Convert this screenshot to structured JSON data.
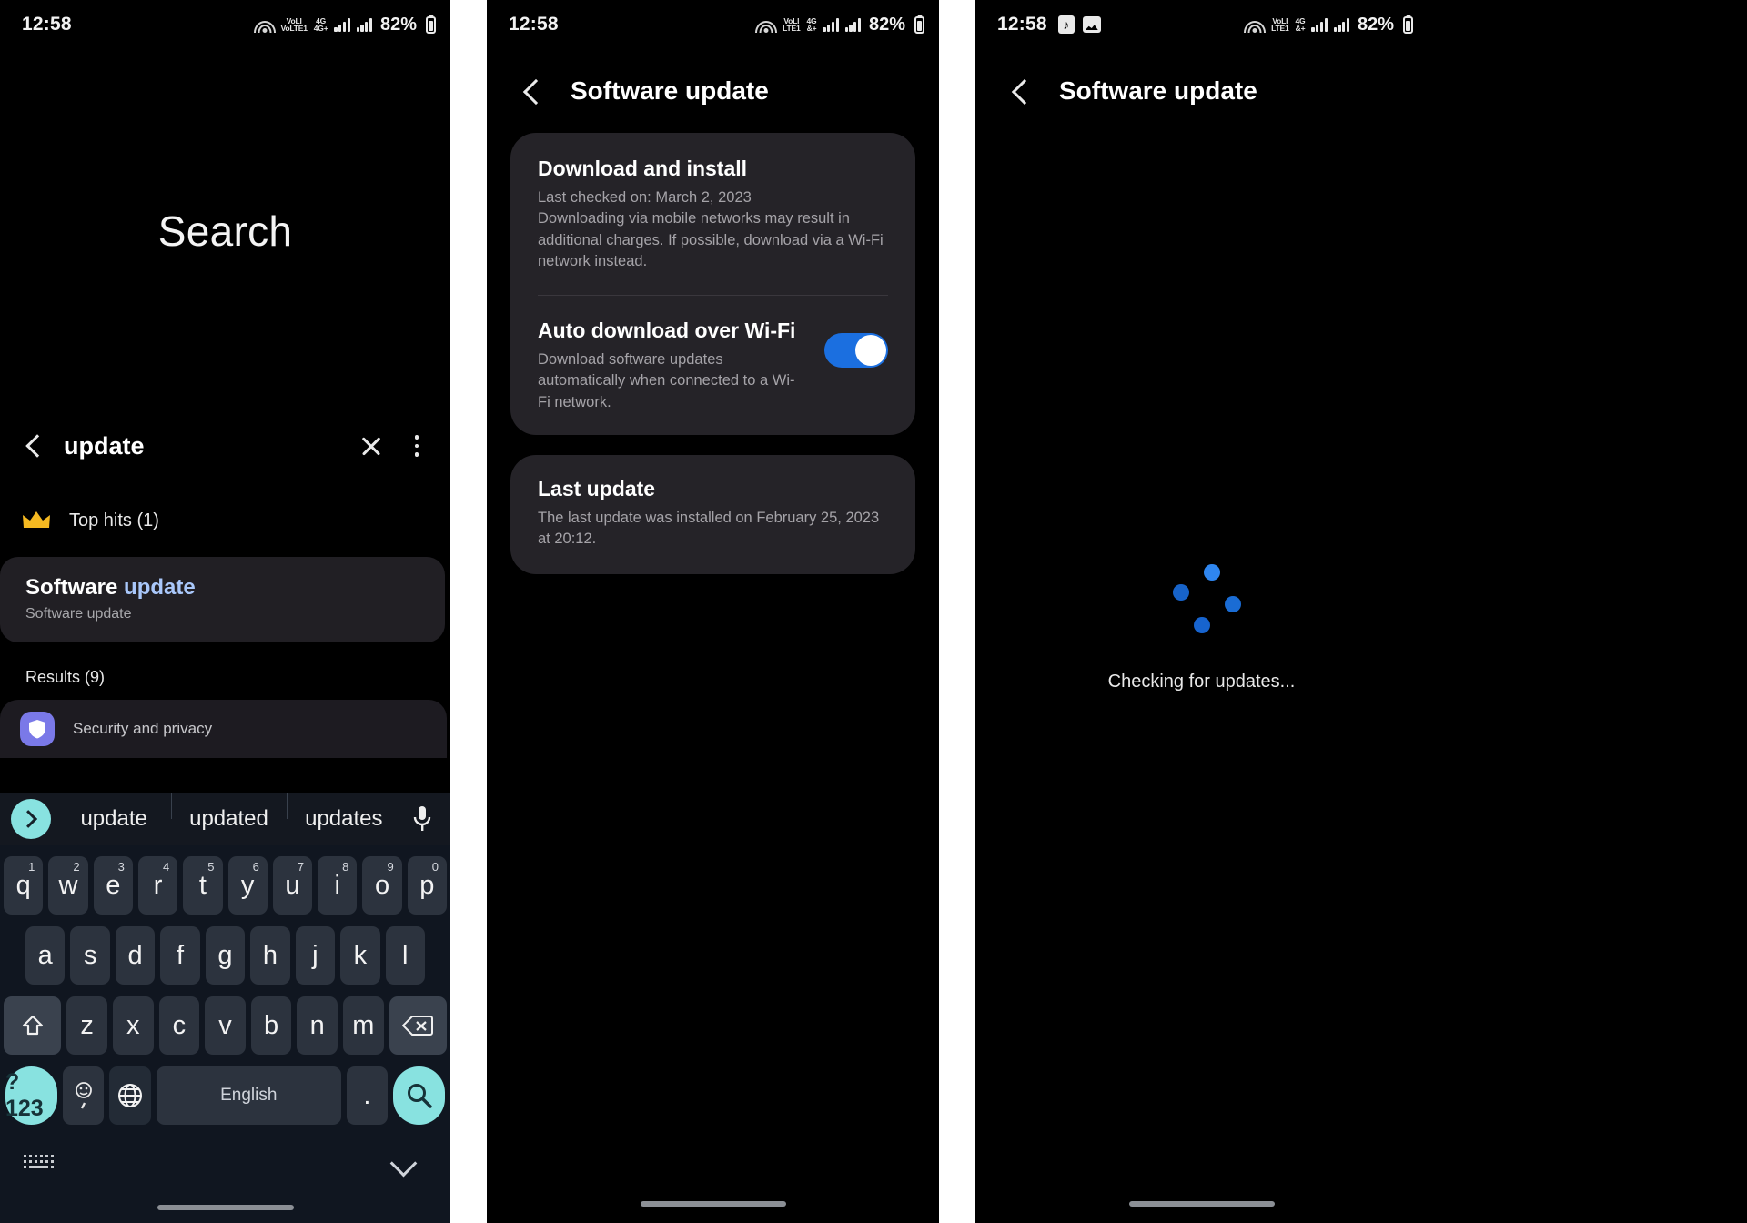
{
  "panels": {
    "search": {
      "status": {
        "time": "12:58",
        "battery": "82%",
        "network_primary": "VoLTE1",
        "network_secondary": "4G+"
      },
      "hero_title": "Search",
      "query": "update",
      "top_hits_label": "Top hits (1)",
      "top_hit": {
        "title_prefix": "Software ",
        "title_match": "update",
        "subtitle": "Software update"
      },
      "results_label": "Results (9)",
      "result_items": [
        {
          "label": "Security and privacy",
          "icon": "shield-icon"
        }
      ],
      "suggestions": [
        "update",
        "updated",
        "updates"
      ],
      "keyboard": {
        "row1": [
          {
            "c": "q",
            "n": "1"
          },
          {
            "c": "w",
            "n": "2"
          },
          {
            "c": "e",
            "n": "3"
          },
          {
            "c": "r",
            "n": "4"
          },
          {
            "c": "t",
            "n": "5"
          },
          {
            "c": "y",
            "n": "6"
          },
          {
            "c": "u",
            "n": "7"
          },
          {
            "c": "i",
            "n": "8"
          },
          {
            "c": "o",
            "n": "9"
          },
          {
            "c": "p",
            "n": "0"
          }
        ],
        "row2": [
          "a",
          "s",
          "d",
          "f",
          "g",
          "h",
          "j",
          "k",
          "l"
        ],
        "row3": [
          "z",
          "x",
          "c",
          "v",
          "b",
          "n",
          "m"
        ],
        "symbols_key": "?123",
        "space_key": "English",
        "period_key": "."
      }
    },
    "software_update": {
      "status": {
        "time": "12:58",
        "battery": "82%"
      },
      "title": "Software update",
      "download_install": {
        "heading": "Download and install",
        "last_checked": "Last checked on: March 2, 2023",
        "note": "Downloading via mobile networks may result in additional charges. If possible, download via a Wi-Fi network instead."
      },
      "auto_download": {
        "heading": "Auto download over Wi-Fi",
        "note": "Download software updates automatically when connected to a Wi-Fi network.",
        "enabled": true
      },
      "last_update": {
        "heading": "Last update",
        "note": "The last update was installed on February 25, 2023 at 20:12."
      }
    },
    "checking": {
      "status": {
        "time": "12:58",
        "battery": "82%"
      },
      "title": "Software update",
      "loading_text": "Checking for updates..."
    }
  },
  "colors": {
    "accent_blue": "#1b6fe0",
    "highlight_blue": "#a9c7fa",
    "key_accent": "#88e2e0",
    "crown_gold": "#f5b921",
    "shield_purple": "#7a79e8",
    "spinner_blue": "#1668d8"
  }
}
